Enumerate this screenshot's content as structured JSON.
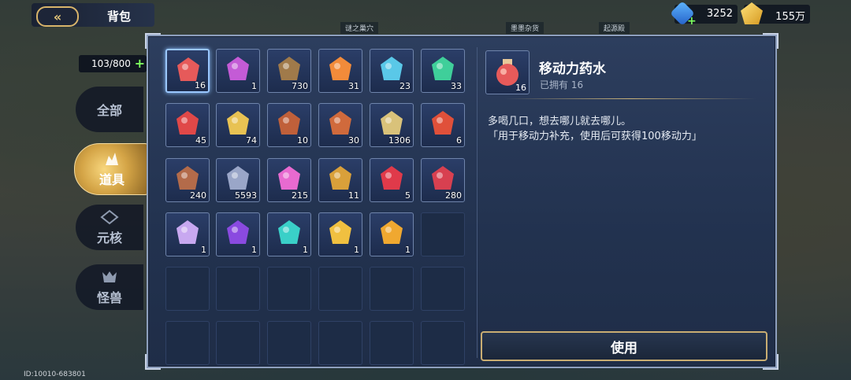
{
  "header": {
    "back_label": "«",
    "title": "背包"
  },
  "currencies": [
    {
      "name": "gem-icon",
      "value": "3252"
    },
    {
      "name": "gold-icon",
      "value": "155万"
    }
  ],
  "map_labels": [
    "谜之巢穴",
    "墨墨杂货",
    "起源殿"
  ],
  "capacity": "103/800",
  "tabs": [
    {
      "label": "全部",
      "active": false
    },
    {
      "label": "道具",
      "active": true
    },
    {
      "label": "元核",
      "active": false
    },
    {
      "label": "怪兽",
      "active": false
    }
  ],
  "items": [
    {
      "name": "potion",
      "count": "16",
      "color": "#e65a5a",
      "selected": true
    },
    {
      "name": "ribbon-charm",
      "count": "1",
      "color": "#c45bd6"
    },
    {
      "name": "wood-bundle",
      "count": "730",
      "color": "#a07a4a"
    },
    {
      "name": "fire-spirit",
      "count": "31",
      "color": "#f28b3a"
    },
    {
      "name": "puzzle-piece",
      "count": "23",
      "color": "#5ac8e8"
    },
    {
      "name": "green-orb",
      "count": "33",
      "color": "#3fcf9a"
    },
    {
      "name": "red-gem",
      "count": "45",
      "color": "#e04848"
    },
    {
      "name": "gold-emblem",
      "count": "74",
      "color": "#e8c253"
    },
    {
      "name": "magnifier-scroll",
      "count": "10",
      "color": "#c0603a"
    },
    {
      "name": "hourglass-badge",
      "count": "30",
      "color": "#d06a3c"
    },
    {
      "name": "gold-ore",
      "count": "1306",
      "color": "#d9c27a"
    },
    {
      "name": "crimson-crystal",
      "count": "6",
      "color": "#e0503a"
    },
    {
      "name": "brick-plank",
      "count": "240",
      "color": "#b36b4a"
    },
    {
      "name": "silver-shield",
      "count": "5593",
      "color": "#9aa6c8"
    },
    {
      "name": "pink-rose",
      "count": "215",
      "color": "#e86ad0"
    },
    {
      "name": "sun-medallion",
      "count": "11",
      "color": "#d9a03a"
    },
    {
      "name": "red-blade",
      "count": "5",
      "color": "#e03a4a"
    },
    {
      "name": "red-shield",
      "count": "280",
      "color": "#d84050"
    },
    {
      "name": "lilac-flower",
      "count": "1",
      "color": "#c8a8f0"
    },
    {
      "name": "purple-crystal",
      "count": "1",
      "color": "#8a4ae0"
    },
    {
      "name": "teal-crystal",
      "count": "1",
      "color": "#3ad0c8"
    },
    {
      "name": "gold-card-1",
      "count": "1",
      "color": "#f0c040"
    },
    {
      "name": "gold-card-2",
      "count": "1",
      "color": "#f0a830"
    }
  ],
  "detail": {
    "name": "移动力药水",
    "owned_label": "已拥有 16",
    "count": "16",
    "desc_1": "多喝几口，想去哪儿就去哪儿。",
    "desc_2": "「用于移动力补充，使用后可获得100移动力」",
    "use_label": "使用"
  },
  "footer_id": "ID:10010-683801"
}
